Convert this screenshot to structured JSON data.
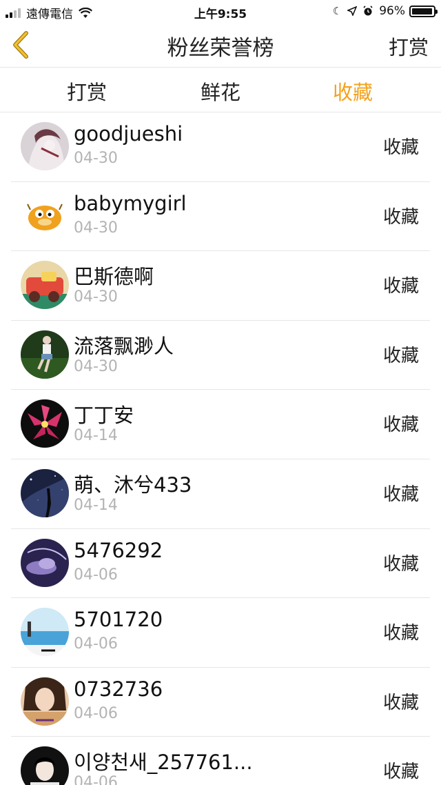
{
  "status_bar": {
    "carrier": "遠傳電信",
    "time": "上午9:55",
    "battery": "96%",
    "battery_level": 0.96,
    "icons": [
      "signal-icon",
      "wifi-icon",
      "moon-icon",
      "location-arrow-icon",
      "alarm-icon",
      "battery-icon"
    ]
  },
  "nav": {
    "back_icon": "chevron-left-icon",
    "title": "粉丝荣誉榜",
    "action": "打赏"
  },
  "tabs": [
    {
      "label": "打赏",
      "active": false
    },
    {
      "label": "鲜花",
      "active": false
    },
    {
      "label": "收藏",
      "active": true
    }
  ],
  "colors": {
    "accent": "#f2a21c",
    "date_text": "#b3b3b3",
    "divider": "#e6e6e6"
  },
  "list": [
    {
      "name": "goodjueshi",
      "date": "04-30",
      "action": "收藏"
    },
    {
      "name": "babymygirl",
      "date": "04-30",
      "action": "收藏"
    },
    {
      "name": "巴斯德啊",
      "date": "04-30",
      "action": "收藏"
    },
    {
      "name": "流落飘渺人",
      "date": "04-30",
      "action": "收藏"
    },
    {
      "name": "丁丁安",
      "date": "04-14",
      "action": "收藏"
    },
    {
      "name": "萌、沐兮433",
      "date": "04-14",
      "action": "收藏"
    },
    {
      "name": "5476292",
      "date": "04-06",
      "action": "收藏"
    },
    {
      "name": "5701720",
      "date": "04-06",
      "action": "收藏"
    },
    {
      "name": "0732736",
      "date": "04-06",
      "action": "收藏"
    },
    {
      "name": "이양천새_257761...",
      "date": "04-06",
      "action": "收藏"
    }
  ]
}
